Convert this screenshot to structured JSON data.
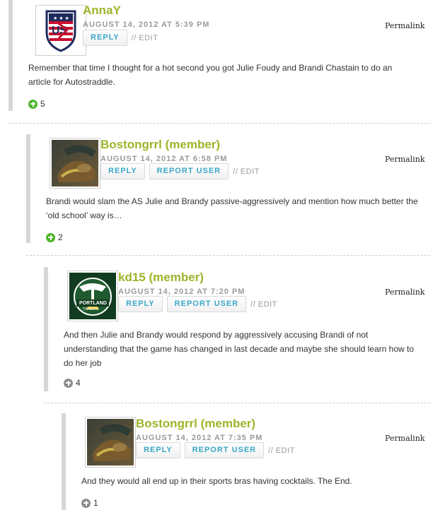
{
  "colors": {
    "author": "#9bb52a",
    "reply": "#3aa7c8",
    "vote_green": "#4db52c",
    "vote_grey": "#8c8c8c",
    "thread_bar": "#d6d6d6"
  },
  "comments": [
    {
      "author": "AnnaY",
      "date": "AUGUST 14, 2012 AT 5:39 PM",
      "reply": "REPLY",
      "report": "",
      "edit": "// EDIT",
      "permalink": "Permalink",
      "text": "Remember that time I thought for a hot second you got Julie Foudy and Brandi Chastain to do an article for Autostraddle.",
      "votes": "5",
      "avatar": "us-soccer-crest"
    },
    {
      "author": "Bostongrrl (member)",
      "date": "AUGUST 14, 2012 AT 6:58 PM",
      "reply": "REPLY",
      "report": "REPORT USER",
      "edit": "// EDIT",
      "permalink": "Permalink",
      "text": "Brandi would slam the AS Julie and Brandy passive-aggressively and mention how much better the ‘old school’ way is…",
      "votes": "2",
      "avatar": "boots-photo"
    },
    {
      "author": "kd15 (member)",
      "date": "AUGUST 14, 2012 AT 7:20 PM",
      "reply": "REPLY",
      "report": "REPORT USER",
      "edit": "// EDIT",
      "permalink": "Permalink",
      "text": "And then Julie and Brandy would respond by aggressively accusing Brandi of not understanding that the game has changed in last decade and maybe she should learn how to do her job",
      "votes": "4",
      "avatar": "portland-timbers-logo"
    },
    {
      "author": "Bostongrrl (member)",
      "date": "AUGUST 14, 2012 AT 7:35 PM",
      "reply": "REPLY",
      "report": "REPORT USER",
      "edit": "// EDIT",
      "permalink": "Permalink",
      "text": "And they would all end up in their sports bras having cocktails. The End.",
      "votes": "1",
      "avatar": "boots-photo"
    }
  ]
}
